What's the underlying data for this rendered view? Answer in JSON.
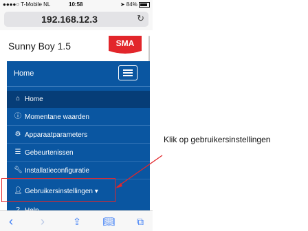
{
  "status_bar": {
    "carrier": "●●●●○ T-Mobile NL",
    "time": "10:58",
    "battery": "84%"
  },
  "browser": {
    "url": "192.168.12.3",
    "reload_icon": "reload-icon"
  },
  "header": {
    "brand": "Sunny Boy 1.5",
    "logo_text": "SMA",
    "logo_color": "#e2262b"
  },
  "nav": {
    "title": "Home",
    "items": [
      {
        "label": "Home",
        "icon": "home-icon"
      },
      {
        "label": "Momentane waarden",
        "icon": "info-icon"
      },
      {
        "label": "Apparaatparameters",
        "icon": "gear-icon"
      },
      {
        "label": "Gebeurtenissen",
        "icon": "list-icon"
      },
      {
        "label": "Installatieconfiguratie",
        "icon": "wrench-icon"
      },
      {
        "label": "Gebruikersinstellingen",
        "icon": "user-icon"
      },
      {
        "label": "Help",
        "icon": "question-icon"
      }
    ],
    "panel_color": "#0a56a1",
    "active_color": "#063d77"
  },
  "annotation": {
    "text": "Klik op gebruikersinstellingen",
    "color": "#e2262b"
  },
  "toolbar": {
    "icons": [
      "back-icon",
      "forward-icon",
      "share-icon",
      "bookmarks-icon",
      "tabs-icon"
    ]
  }
}
